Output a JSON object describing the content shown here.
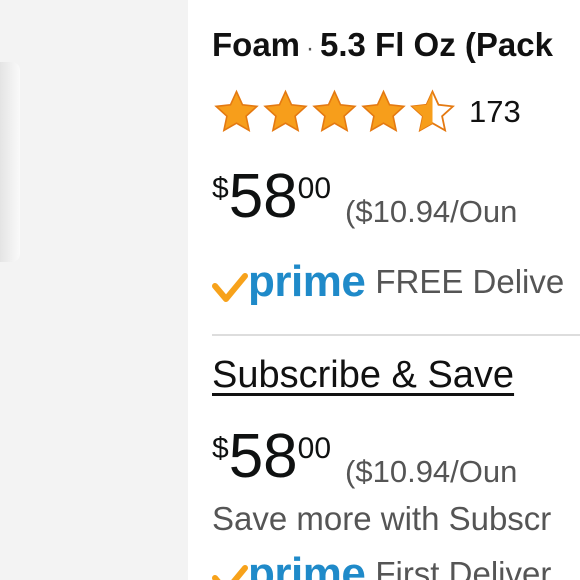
{
  "product": {
    "title_part": "Foam",
    "separator": "·",
    "size": "5.3 Fl Oz (Pack"
  },
  "rating": {
    "stars": 4.5,
    "max_stars": 5,
    "review_count": "173",
    "star_color": "#f79e1b"
  },
  "price": {
    "currency": "$",
    "whole": "58",
    "fraction": "00",
    "unit_price": "($10.94/Oun"
  },
  "prime": {
    "logo_text": "prime",
    "delivery": "FREE Delive",
    "brand_color": "#1f8ac9",
    "check_color": "#f7a21b"
  },
  "subscribe": {
    "heading": "Subscribe & Save",
    "currency": "$",
    "whole": "58",
    "fraction": "00",
    "unit_price": "($10.94/Oun",
    "save_more": "Save more with Subscr",
    "prime_logo_text": "prime",
    "delivery": "First Deliver"
  }
}
